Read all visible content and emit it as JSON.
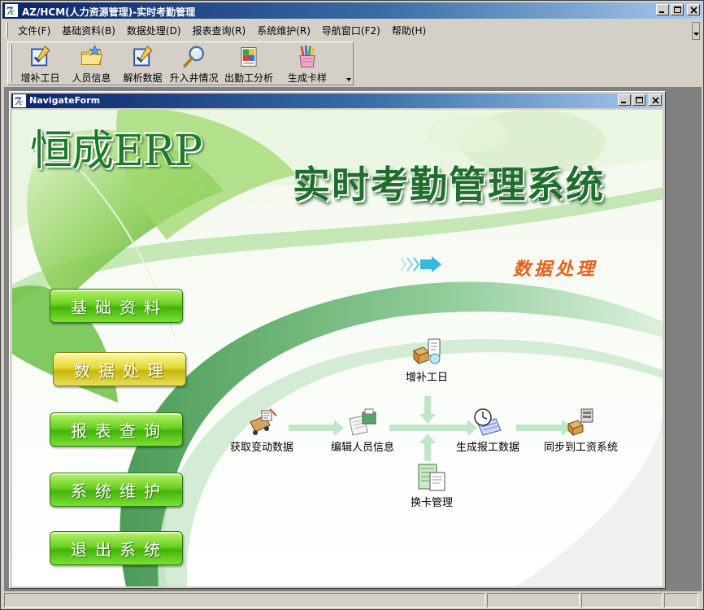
{
  "window": {
    "title": "AZ/HCM(人力资源管理)-实时考勤管理"
  },
  "menu": {
    "items": [
      {
        "label": "文件(F)"
      },
      {
        "label": "基础资料(B)"
      },
      {
        "label": "数据处理(D)"
      },
      {
        "label": "报表查询(R)"
      },
      {
        "label": "系统维护(R)"
      },
      {
        "label": "导航窗口(F2)"
      },
      {
        "label": "帮助(H)"
      }
    ]
  },
  "toolbar": {
    "buttons": [
      {
        "label": "增补工日",
        "icon": "edit-checkbox-icon"
      },
      {
        "label": "人员信息",
        "icon": "folder-star-icon"
      },
      {
        "label": "解析数据",
        "icon": "edit-checkbox-icon"
      },
      {
        "label": "升入井情况",
        "icon": "magnifier-icon"
      },
      {
        "label": "出勤工分析",
        "icon": "puzzle-document-icon"
      },
      {
        "label": "生成卡样",
        "icon": "pencil-cup-icon"
      }
    ]
  },
  "child_window": {
    "title": "NavigateForm"
  },
  "navigate": {
    "brand": "恒成ERP",
    "system_title": "实时考勤管理系统",
    "section_label": "数据处理",
    "nav_buttons": [
      {
        "label": "基础资料",
        "active": false
      },
      {
        "label": "数据处理",
        "active": true
      },
      {
        "label": "报表查询",
        "active": false
      },
      {
        "label": "系统维护",
        "active": false
      },
      {
        "label": "退出系统",
        "active": false
      }
    ],
    "flow": {
      "get_changes": "获取变动数据",
      "edit_staff": "编辑人员信息",
      "add_workday": "增补工日",
      "generate_report": "生成报工数据",
      "card_change": "换卡管理",
      "sync_payroll": "同步到工资系统"
    }
  },
  "colors": {
    "title_bar": "#0a246a",
    "brand_green": "#1b7a25",
    "button_green": "#6bd123",
    "button_active": "#e4d836",
    "section_orange": "#e8601a"
  }
}
